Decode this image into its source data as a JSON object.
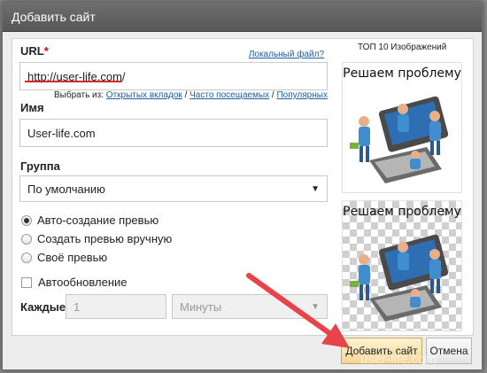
{
  "dialog": {
    "title": "Добавить сайт"
  },
  "url": {
    "label": "URL",
    "required_mark": "*",
    "value": "http://user-life.com/",
    "local_file_link": "Локальный файл?",
    "choose_prefix": "Выбрать из: ",
    "choose_open_tabs": "Открытых вкладок",
    "choose_frequent": "Часто посещаемых",
    "choose_popular": "Популярных",
    "separator": " / "
  },
  "name": {
    "label": "Имя",
    "value": "User-life.com"
  },
  "group": {
    "label": "Группа",
    "value": "По умолчанию"
  },
  "preview": {
    "options": [
      "Авто-создание превью",
      "Создать превью вручную",
      "Своё превью"
    ],
    "selected_index": 0
  },
  "autoupdate": {
    "label": "Автообновление",
    "checked": false,
    "every_label": "Каждые",
    "every_value": "1",
    "unit_value": "Минуты"
  },
  "thumbnails": {
    "heading": "ТОП 10 Изображений",
    "items": [
      {
        "caption": "Решаем проблему",
        "background": "white"
      },
      {
        "caption": "Решаем проблему",
        "background": "transparent"
      }
    ]
  },
  "buttons": {
    "add": "Добавить сайт",
    "cancel": "Отмена"
  },
  "watermark": "user-life.com",
  "colors": {
    "arrow": "#e8434b",
    "underline": "#d12b2b",
    "link": "#1a5fa8"
  }
}
